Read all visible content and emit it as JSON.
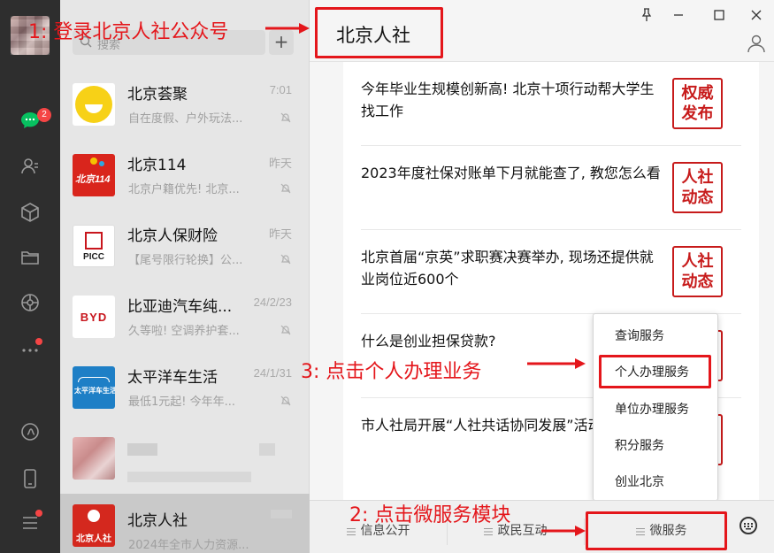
{
  "rail": {
    "unread_count": "2",
    "icons": [
      "chat-icon",
      "contacts-icon",
      "favorites-icon",
      "files-icon",
      "moments-icon",
      "more-icon",
      "mini-program-icon",
      "phone-icon",
      "menu-icon"
    ]
  },
  "search": {
    "placeholder": "搜索",
    "add_label": "+"
  },
  "chats": [
    {
      "name": "北京荟聚",
      "time": "7:01",
      "preview": "自在度假、户外玩法..."
    },
    {
      "name": "北京114",
      "time": "昨天",
      "preview": "北京户籍优先! 北京..."
    },
    {
      "name": "北京人保财险",
      "time": "昨天",
      "preview": "【尾号限行轮换】公..."
    },
    {
      "name": "比亚迪汽车纯...",
      "time": "24/2/23",
      "preview": "久等啦! 空调养护套..."
    },
    {
      "name": "太平洋车生活",
      "time": "24/1/31",
      "preview": "最低1元起! 今年年..."
    },
    {
      "name": "",
      "time": "",
      "preview": ""
    },
    {
      "name": "北京人社",
      "time": "",
      "preview": "2024年全市人力资源..."
    }
  ],
  "thumb_text": {
    "b114": "北京114",
    "picc": "PICC",
    "byd": "BYD",
    "tpy": "太平洋车生活",
    "rs": "北京人社"
  },
  "header": {
    "title": "北京人社"
  },
  "articles": [
    {
      "title": "今年毕业生规模创新高! 北京十项行动帮大学生找工作",
      "tag": "权威发布"
    },
    {
      "title": "2023年度社保对账单下月就能查了, 教您怎么看",
      "tag": "人社动态"
    },
    {
      "title": "北京首届“京英”求职赛决赛举办, 现场还提供就业岗位近600个",
      "tag": "人社动态"
    },
    {
      "title": "什么是创业担保贷款?",
      "tag": ""
    },
    {
      "title": "市人社局开展“人社共话协同发展”活动",
      "tag": ""
    }
  ],
  "menu": {
    "items": [
      "查询服务",
      "个人办理服务",
      "单位办理服务",
      "积分服务",
      "创业北京"
    ]
  },
  "bottom_menu": {
    "items": [
      "信息公开",
      "政民互动",
      "微服务"
    ]
  },
  "annotations": {
    "step1": "1: 登录北京人社公众号",
    "step2": "2: 点击微服务模块",
    "step3": "3: 点击个人办理业务"
  },
  "colors": {
    "annotation": "#e4161b",
    "tag_red": "#c71b1b",
    "badge": "#f54545",
    "rail": "#2e2e2e"
  }
}
